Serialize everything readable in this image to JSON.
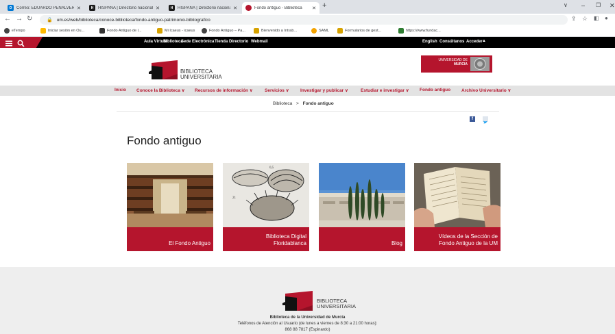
{
  "browser": {
    "tabs": [
      {
        "title": "Correo: EDUARDO PEÑALVER GO",
        "color": "#0078d4",
        "glyph": "O"
      },
      {
        "title": "HISPANA | Directorio nacional de",
        "color": "#1a1a1a",
        "glyph": "H"
      },
      {
        "title": "HISPANA | Directorio nacional de",
        "color": "#1a1a1a",
        "glyph": "H"
      },
      {
        "title": "Fondo antiguo - Biblioteca",
        "color": "#b5152d",
        "glyph": "●"
      }
    ],
    "new_tab_icon": "plus-icon",
    "url": "um.es/web/biblioteca/conoce-biblioteca/fondo-antiguo-patrimonio-bibliografico",
    "bookmarks": [
      {
        "label": "eTempo",
        "color": "#444"
      },
      {
        "label": "Iniciar sesión en Ou...",
        "color": "#ffb900"
      },
      {
        "label": "Fondo Antiguo de l...",
        "color": "#333"
      },
      {
        "label": "Mi Icaeus - icaeus",
        "color": "#d6a200"
      },
      {
        "label": "Fondo Antiguo – Pa...",
        "color": "#444"
      },
      {
        "label": "Bienvenido a Intrab...",
        "color": "#d6a200"
      },
      {
        "label": "SAML",
        "color": "#f4a300"
      },
      {
        "label": "Formularios de gest...",
        "color": "#d6a200"
      },
      {
        "label": "https://www.fundac...",
        "color": "#2e7d32"
      }
    ]
  },
  "site": {
    "accent": "#b5152d",
    "top_links": [
      "Aula Virtual",
      "Biblioteca",
      "Sede Electrónica",
      "Tienda",
      "Directorio",
      "Webmail"
    ],
    "top_right": [
      "English",
      "Consúltanos",
      "Acceder"
    ],
    "logo_line1": "BIBLIOTECA",
    "logo_line2": "UNIVERSITARIA",
    "um_logo_line1": "UNIVERSIDAD DE",
    "um_logo_line2": "MURCIA",
    "nav": [
      "Inicio",
      "Conoce la Biblioteca ∨",
      "Recursos de información ∨",
      "Servicios ∨",
      "Investigar y publicar ∨",
      "Estudiar e investigar ∨",
      "Fondo antiguo",
      "Archivo Universitario ∨"
    ],
    "breadcrumb": {
      "parent": "Biblioteca",
      "sep": ">",
      "current": "Fondo antiguo"
    },
    "share_icons": [
      "facebook-icon",
      "twitter-icon"
    ],
    "page_title": "Fondo antiguo",
    "cards": [
      {
        "line1": "El Fondo Antiguo",
        "line2": ""
      },
      {
        "line1": "Biblioteca Digital",
        "line2": "Floridablanca"
      },
      {
        "line1": "Blog",
        "line2": ""
      },
      {
        "line1": "Vídeos de la Sección de",
        "line2": "Fondo Antiguo de la UM"
      }
    ],
    "footer": {
      "logo_line1": "BIBLIOTECA",
      "logo_line2": "UNIVERSITARIA",
      "org": "Biblioteca de la Universidad de Murcia",
      "phones_label": "Teléfonos de Atención al Usuario (de lunes a viernes de 8:30 a 21:00 horas):",
      "phone1": "868 88 7817 (Espinardo)"
    }
  }
}
